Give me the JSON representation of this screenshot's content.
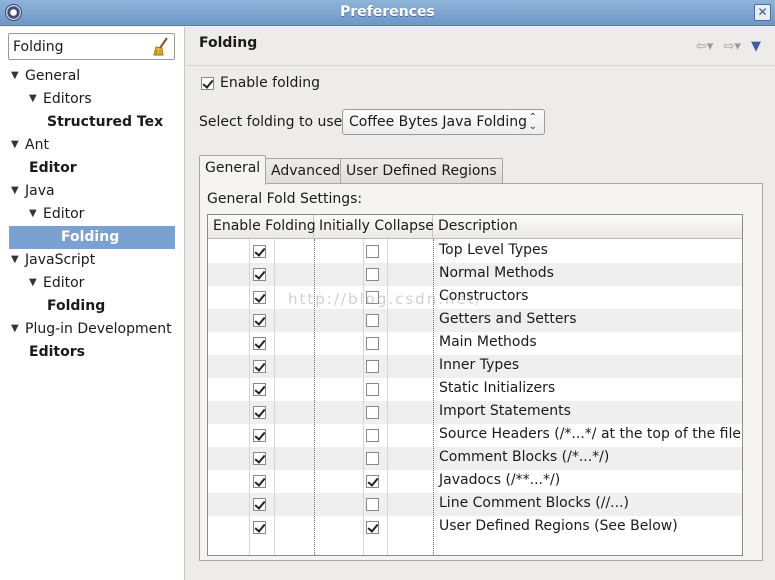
{
  "window": {
    "title": "Preferences"
  },
  "filter": {
    "value": "Folding"
  },
  "tree": [
    {
      "label": "General",
      "twisty": "▼",
      "indent": 0,
      "bold": false,
      "selected": false
    },
    {
      "label": "Editors",
      "twisty": "▼",
      "indent": 1,
      "bold": false,
      "selected": false
    },
    {
      "label": "Structured Tex",
      "twisty": "",
      "indent": 2,
      "bold": true,
      "selected": false
    },
    {
      "label": "Ant",
      "twisty": "▼",
      "indent": 0,
      "bold": false,
      "selected": false
    },
    {
      "label": "Editor",
      "twisty": "",
      "indent": 1,
      "bold": true,
      "selected": false
    },
    {
      "label": "Java",
      "twisty": "▼",
      "indent": 0,
      "bold": false,
      "selected": false
    },
    {
      "label": "Editor",
      "twisty": "▼",
      "indent": 1,
      "bold": false,
      "selected": false
    },
    {
      "label": "Folding",
      "twisty": "",
      "indent": 2,
      "bold": true,
      "selected": true
    },
    {
      "label": "JavaScript",
      "twisty": "▼",
      "indent": 0,
      "bold": false,
      "selected": false
    },
    {
      "label": "Editor",
      "twisty": "▼",
      "indent": 1,
      "bold": false,
      "selected": false
    },
    {
      "label": "Folding",
      "twisty": "",
      "indent": 2,
      "bold": true,
      "selected": false
    },
    {
      "label": "Plug-in Development",
      "twisty": "▼",
      "indent": 0,
      "bold": false,
      "selected": false
    },
    {
      "label": "Editors",
      "twisty": "",
      "indent": 1,
      "bold": true,
      "selected": false
    }
  ],
  "page": {
    "title": "Folding",
    "enable_folding": {
      "label": "Enable folding",
      "checked": true
    },
    "select": {
      "label": "Select folding to use:",
      "value": "Coffee Bytes Java Folding"
    },
    "tabs": [
      {
        "label": "General",
        "active": true
      },
      {
        "label": "Advanced",
        "active": false
      },
      {
        "label": "User Defined Regions",
        "active": false
      }
    ],
    "panel_label": "General Fold Settings:",
    "columns": [
      "Enable Folding",
      "Initially Collapse",
      "Description"
    ],
    "rows": [
      {
        "enable": true,
        "collapse": false,
        "desc": "Top Level Types"
      },
      {
        "enable": true,
        "collapse": false,
        "desc": "Normal Methods"
      },
      {
        "enable": true,
        "collapse": false,
        "desc": "Constructors"
      },
      {
        "enable": true,
        "collapse": false,
        "desc": "Getters and Setters"
      },
      {
        "enable": true,
        "collapse": false,
        "desc": "Main Methods"
      },
      {
        "enable": true,
        "collapse": false,
        "desc": "Inner Types"
      },
      {
        "enable": true,
        "collapse": false,
        "desc": "Static Initializers"
      },
      {
        "enable": true,
        "collapse": false,
        "desc": "Import Statements"
      },
      {
        "enable": true,
        "collapse": false,
        "desc": "Source Headers (/*...*/ at the top of the file)"
      },
      {
        "enable": true,
        "collapse": false,
        "desc": "Comment Blocks (/*...*/)"
      },
      {
        "enable": true,
        "collapse": true,
        "desc": "Javadocs (/**...*/)"
      },
      {
        "enable": true,
        "collapse": false,
        "desc": "Line Comment Blocks (//...)"
      },
      {
        "enable": true,
        "collapse": true,
        "desc": "User Defined Regions (See Below)"
      }
    ]
  },
  "watermark": "http://blog.csdn.net/"
}
